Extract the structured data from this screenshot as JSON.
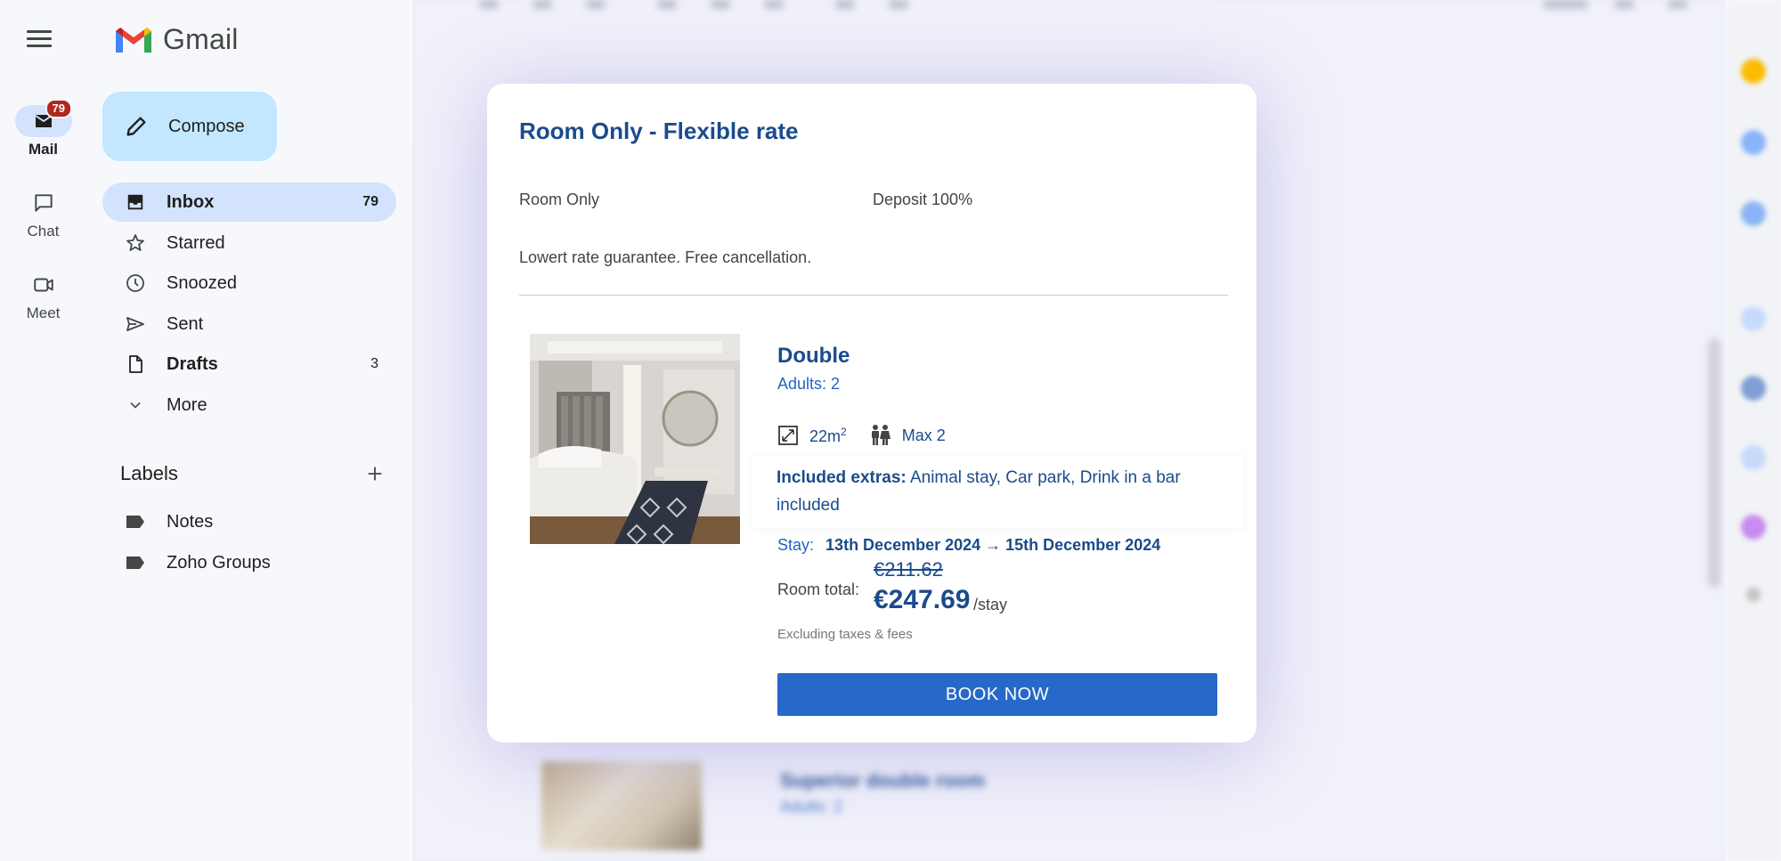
{
  "app": {
    "name": "Gmail"
  },
  "rail": {
    "items": [
      {
        "label": "Mail",
        "badge": "79",
        "icon": "mail-icon",
        "active": true
      },
      {
        "label": "Chat",
        "icon": "chat-icon"
      },
      {
        "label": "Meet",
        "icon": "video-icon"
      }
    ]
  },
  "sidebar": {
    "compose_label": "Compose",
    "nav": [
      {
        "label": "Inbox",
        "count": "79",
        "icon": "inbox-icon"
      },
      {
        "label": "Starred",
        "icon": "star-icon"
      },
      {
        "label": "Snoozed",
        "icon": "clock-icon"
      },
      {
        "label": "Sent",
        "icon": "send-icon"
      },
      {
        "label": "Drafts",
        "count": "3",
        "icon": "draft-icon"
      },
      {
        "label": "More",
        "icon": "chevron-down-icon"
      }
    ],
    "labels_title": "Labels",
    "labels": [
      {
        "label": "Notes",
        "icon": "label-icon"
      },
      {
        "label": "Zoho Groups",
        "icon": "label-icon"
      }
    ]
  },
  "modal": {
    "title": "Room Only - Flexible rate",
    "board": "Room Only",
    "deposit": "Deposit 100%",
    "description": "Lowert rate guarantee. Free cancellation.",
    "room": {
      "name": "Double",
      "adults": "Adults: 2",
      "size": "22m",
      "size_sup": "2",
      "max": "Max 2",
      "extras_label": "Included extras:",
      "extras_text": "Animal stay, Car park, Drink in a bar included",
      "stay_label": "Stay:",
      "stay_dates": "13th December 2024 → 15th December 2024",
      "old_price": "€211.62",
      "total_label": "Room total:",
      "price": "€247.69",
      "per": "/stay",
      "excluding": "Excluding taxes & fees",
      "book_label": "BOOK NOW"
    }
  },
  "background": {
    "next_room_title": "Superior double room",
    "next_room_sub": "Adults: 2"
  },
  "colors": {
    "brand_blue": "#1a4b8c",
    "button_blue": "#2669c9",
    "compose_bg": "#c2e7ff",
    "active_nav": "#d3e3fd",
    "badge_red": "#b3261e"
  }
}
